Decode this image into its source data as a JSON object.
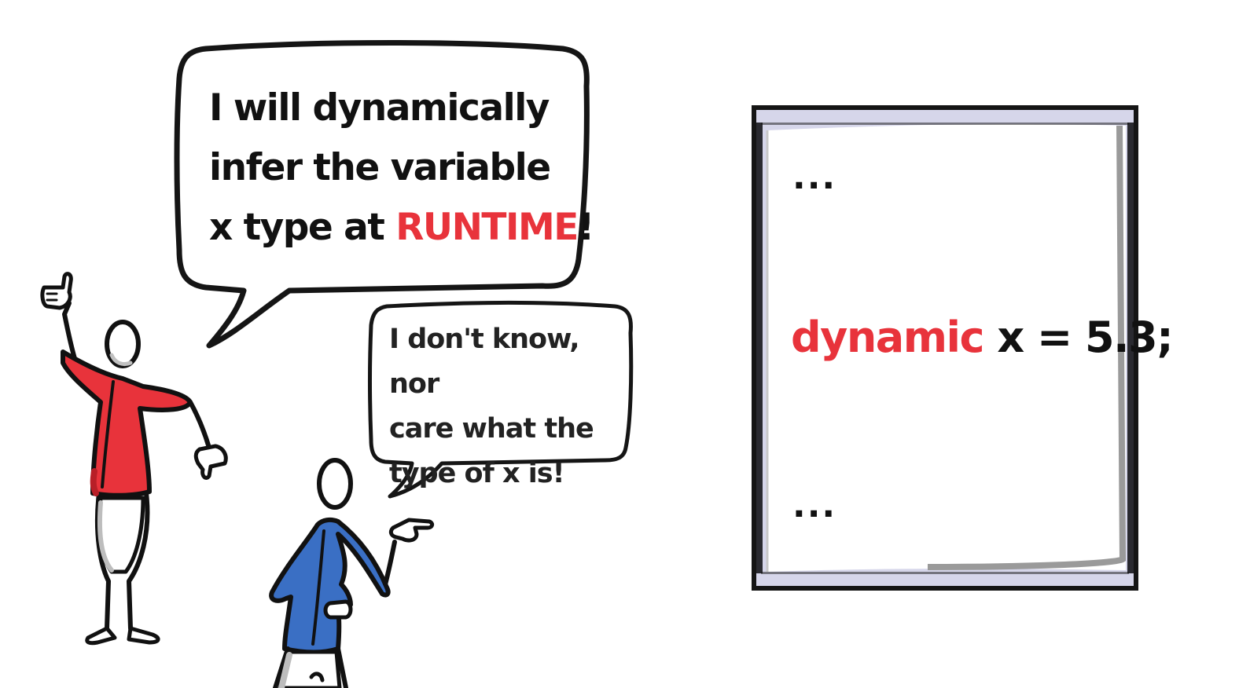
{
  "speech": {
    "first": {
      "line1": "I will dynamically",
      "line2": "infer the variable",
      "line3_prefix": "x type at ",
      "line3_emphasis": "RUNTIME",
      "line3_suffix": "!"
    },
    "second": {
      "line1": "I don't know, nor",
      "line2": "care what the",
      "line3": "type of x is!"
    }
  },
  "code_panel": {
    "ellipsis_top": "...",
    "keyword": "dynamic",
    "statement_rest": " x = 5.3;",
    "ellipsis_bottom": "..."
  },
  "colors": {
    "accent": "#e8333b",
    "shirt_red": "#e8333b",
    "shirt_blue": "#3a6fc4",
    "outline": "#111111",
    "frame": "#d6d6ea"
  },
  "icons": {
    "figure_left": "stick-figure-red-shirt",
    "figure_right": "stick-figure-blue-shirt"
  }
}
